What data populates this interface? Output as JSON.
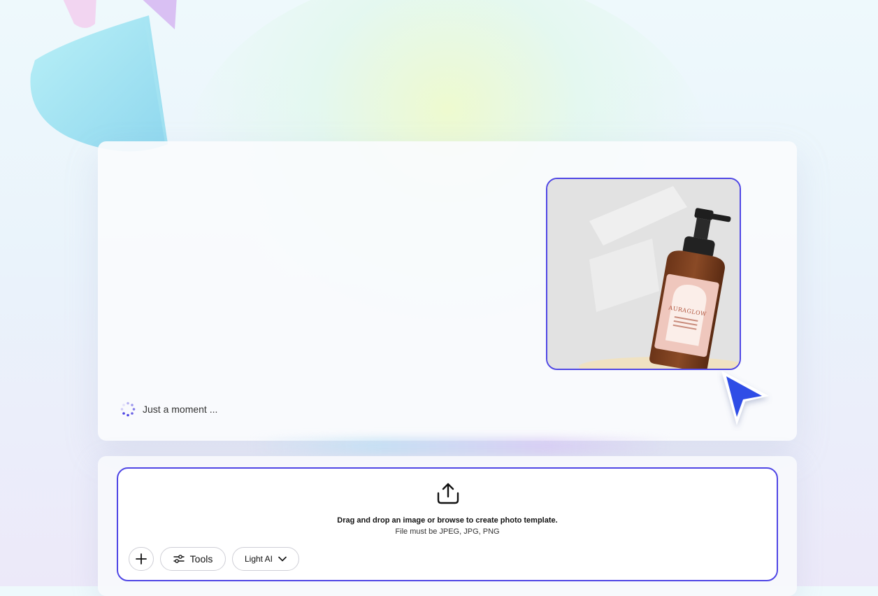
{
  "status": {
    "text": "Just a moment ..."
  },
  "upload": {
    "title": "Drag and drop an image or browse to create photo template.",
    "subtitle": "File must be JPEG, JPG, PNG"
  },
  "toolbar": {
    "tools_label": "Tools",
    "model_label": "Light AI"
  },
  "product": {
    "brand": "AURAGLOW"
  },
  "colors": {
    "accent": "#4f46e5",
    "cursor": "#2f4de6"
  }
}
